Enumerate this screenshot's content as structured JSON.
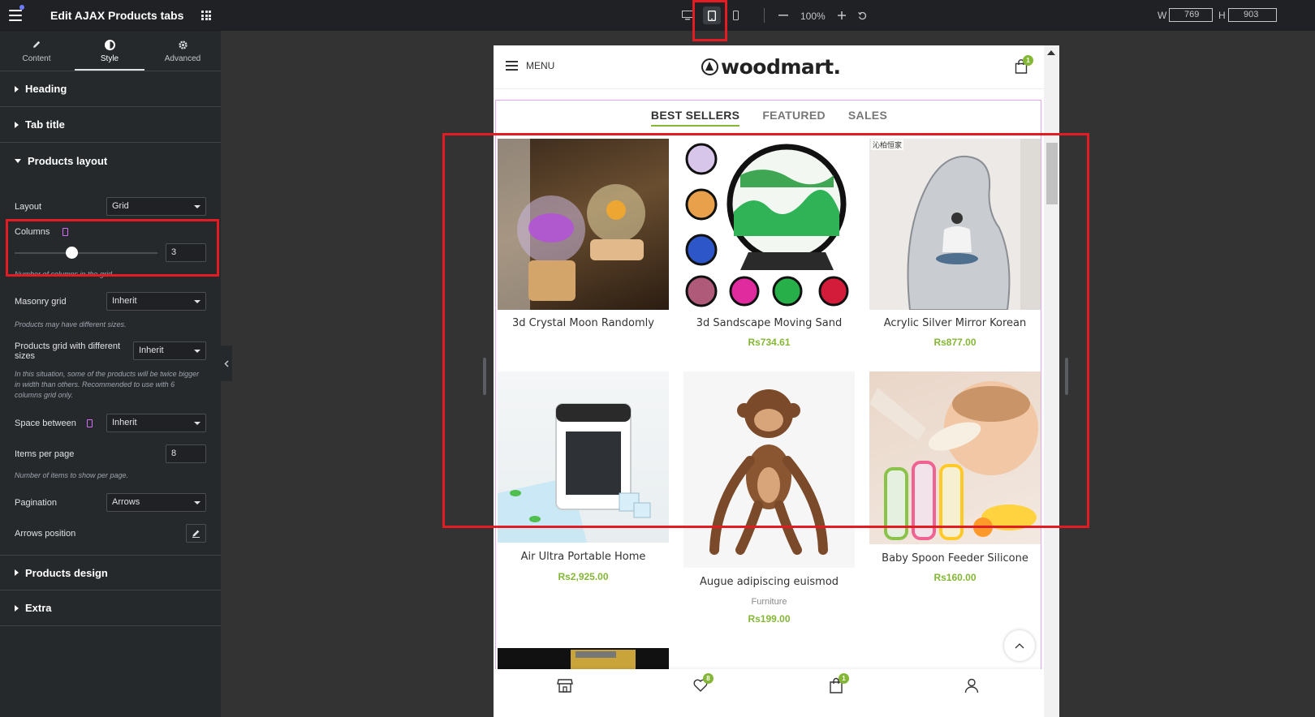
{
  "panel": {
    "title": "Edit AJAX Products tabs",
    "tabs": [
      {
        "label": "Content",
        "icon": "pencil-icon"
      },
      {
        "label": "Style",
        "icon": "contrast-icon"
      },
      {
        "label": "Advanced",
        "icon": "gear-icon"
      }
    ],
    "sections": {
      "heading": "Heading",
      "tab_title": "Tab title",
      "products_layout": "Products layout",
      "products_design": "Products design",
      "extra": "Extra"
    },
    "controls": {
      "layout_label": "Layout",
      "layout_value": "Grid",
      "columns_label": "Columns",
      "columns_value": "3",
      "columns_slider_fraction": 0.4,
      "columns_help": "Number of columns in the grid.",
      "masonry_label": "Masonry grid",
      "masonry_value": "Inherit",
      "masonry_help": "Products may have different sizes.",
      "diff_sizes_label": "Products grid with different sizes",
      "diff_sizes_value": "Inherit",
      "diff_sizes_help": "In this situation, some of the products will be twice bigger in width than others. Recommended to use with 6 columns grid only.",
      "space_label": "Space between",
      "space_value": "Inherit",
      "items_label": "Items per page",
      "items_value": "8",
      "items_help": "Number of items to show per page.",
      "pagination_label": "Pagination",
      "pagination_value": "Arrows",
      "arrows_label": "Arrows position"
    }
  },
  "topbar": {
    "zoom": "100%",
    "width_label": "W",
    "width_value": "769",
    "height_label": "H",
    "height_value": "903"
  },
  "site": {
    "menu_label": "MENU",
    "logo": "woodmart.",
    "cart_count": "1",
    "tabs": [
      "BEST SELLERS",
      "FEATURED",
      "SALES"
    ],
    "products": [
      {
        "name": "3d Crystal Moon Randomly",
        "price": ""
      },
      {
        "name": "3d Sandscape Moving Sand",
        "price": "Rs734.61"
      },
      {
        "name": "Acrylic Silver Mirror Korean",
        "price": "Rs877.00"
      },
      {
        "name": "Air Ultra Portable Home",
        "price": "Rs2,925.00"
      },
      {
        "name": "Augue adipiscing euismod",
        "category": "Furniture",
        "price": "Rs199.00"
      },
      {
        "name": "Baby Spoon Feeder Silicone",
        "price": "Rs160.00"
      }
    ],
    "image_watermark": "沁柏恒家",
    "bottom_bar": {
      "wishlist_count": "8",
      "cart_count": "1"
    }
  },
  "colors": {
    "accent_green": "#83b735",
    "annotation_red": "#e31c23",
    "panel_bg": "#26292c",
    "canvas_bg": "#333333"
  }
}
